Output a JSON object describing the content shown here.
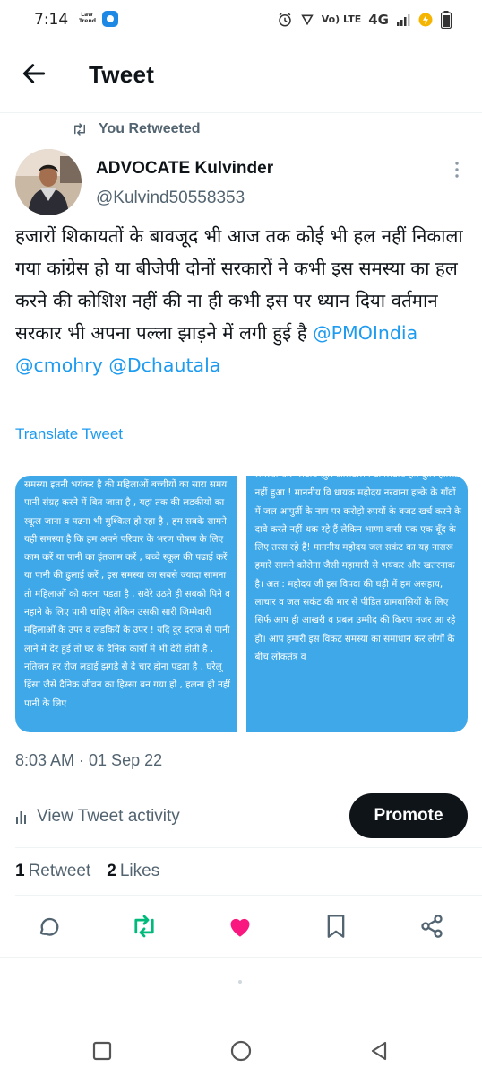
{
  "status_bar": {
    "time": "7:14",
    "app_icon_1_text": "Law Trend",
    "network_label": "Vo) LTE",
    "network_type": "4G"
  },
  "header": {
    "title": "Tweet"
  },
  "retweet_context": {
    "label": "You Retweeted"
  },
  "author": {
    "display_name": "ADVOCATE Kulvinder",
    "handle": "@Kulvind50558353"
  },
  "tweet": {
    "text": "हजारों शिकायतों के बावजूद भी आज तक कोई भी हल नहीं निकाला गया कांग्रेस हो या बीजेपी दोनों सरकारों ने कभी इस समस्या का हल करने की कोशिश नहीं की ना ही कभी इस पर ध्यान दिया वर्तमान सरकार भी  अपना पल्ला झाड़ने में लगी हुई है",
    "mention_1": "@PMOIndia",
    "mention_2": "@cmohry",
    "mention_3": "@Dchautala",
    "translate_label": "Translate Tweet"
  },
  "media": {
    "left_text": "समस्या इतनी भयंकर है की महिलाओं बच्चीयों का सारा समय पानी संग्रह करने में बित जाता है , यहां तक की लडकीयों का स्कूल जाना व पढना भी मुश्किल हो रहा है , हम सबके सामने यही समस्या है कि हम अपने परिवार के भरण पोषण के लिए काम करें या पानी का इंतजाम करें , बच्चे स्कूल की पढाई करें या पानी की ढुलाई करें , इस समस्या का सबसे ज्यादा सामना तो महिलाओं को करना पडता है , सवेरे उठते ही सबको पिने व नहाने के लिए  पानी चाहिए  लेकिन उसकी सारी जिम्मेवारी महिलाओं के उपर व लडकियें के उपर ! यदि दुर दराज से पानी लाने में देर हुई  तो घर के दैनिक कार्यों में भी देरी होती है , नतिजन हर रोज लडाई झगडे से दे चार होना पडता है , घरेलू हिंसा जैसे दैनिक जीवन का हिस्सा बन गया हो ,  हलना ही नहीं पानी के लिए",
    "right_text": "समस्या यार सिवाय झुठे आसवासन के सिवाय हमें कुछ हासिल नहीं हुआ !  माननीय वि धायक महोदय नरवाना हल्के के गाँवों में जल आपुर्ती के नाम पर करोड़ो रुपयों के बजट खर्च करने के दावे करते नहीं थक रहे हैं लेकिन भाणा वासी एक एक बूँद के लिए तरस रहे हैं! माननीय महोदय जल सकंट  का यह नासरू हमारे सामने कोरोना जैसी महामारी से भयंकर और खतरनाक है। अत : महोदय जी इस विपदा की घड़ी में हम असहाय, लाचार व जल सकंट की मार से पीडित ग्रामवासियों के लिए  सिर्फ आप ही आखरी व प्रबल उम्मीद की किरण  नजर आ रहे हो। आप हमारी इस विकट समस्या का समाधान कर लोगों के बीच लोकतंत्र व"
  },
  "meta": {
    "timestamp": "8:03 AM · 01 Sep 22",
    "activity_label": "View Tweet activity",
    "promote_label": "Promote"
  },
  "stats": {
    "retweets_count": "1",
    "retweets_label": "Retweet",
    "likes_count": "2",
    "likes_label": "Likes"
  },
  "colors": {
    "accent_blue": "#1d9bf0",
    "retweet_green": "#00ba7c",
    "like_pink": "#f91880",
    "secondary_text": "#536471",
    "media_blue": "#3fa8e8"
  }
}
